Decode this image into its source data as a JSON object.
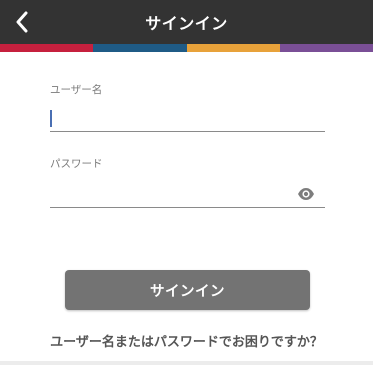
{
  "header": {
    "title": "サインイン",
    "back_icon": "chevron-left-icon"
  },
  "stripe_colors": [
    "#c6203e",
    "#1f5b86",
    "#e8a23a",
    "#7a4f96"
  ],
  "form": {
    "username_label": "ユーザー名",
    "username_value": "",
    "password_label": "パスワード",
    "password_value": "",
    "password_toggle_icon": "eye-icon"
  },
  "signin_button_label": "サインイン",
  "help_link_text": "ユーザー名またはパスワードでお困りですか？",
  "colors": {
    "header_bg": "#333333",
    "button_bg": "#737373",
    "caret": "#4a6fb3"
  }
}
